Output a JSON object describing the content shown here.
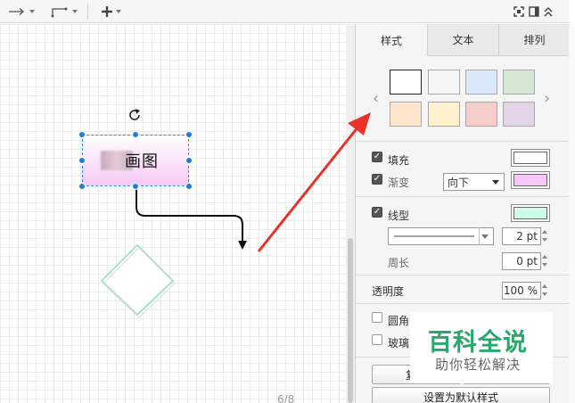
{
  "toolbar": {
    "connection_icon": "arrow-right-icon",
    "waypoint_icon": "waypoint-icon",
    "insert_icon": "plus-icon",
    "right_icons": [
      "fit-icon",
      "format-panel-icon",
      "collapse-icon"
    ]
  },
  "canvas": {
    "shape_label": "画图",
    "shape_gradient_color": "#f7c8f5",
    "diamond_stroke": "#9fe7c9",
    "page_indicator": "6/8"
  },
  "panel": {
    "tabs": [
      "样式",
      "文本",
      "排列"
    ],
    "active_tab": "样式",
    "swatches": [
      "#ffffff",
      "#f5f5f5",
      "#dae8fc",
      "#d5e8d4",
      "#ffe6cc",
      "#fff2cc",
      "#f8cecc",
      "#e1d5e7"
    ],
    "fill": {
      "label": "填充",
      "checked": true,
      "color": "#ffffff"
    },
    "gradient": {
      "label": "渐变",
      "checked": true,
      "direction": "向下",
      "color": "#f7c8f5"
    },
    "line": {
      "label": "线型",
      "checked": true,
      "color": "#ccffe6",
      "width": "2 pt"
    },
    "perimeter": {
      "label": "周长",
      "value": "0 pt"
    },
    "opacity": {
      "label": "透明度",
      "value": "100 %"
    },
    "rounded": {
      "label": "圆角",
      "checked": false
    },
    "glass": {
      "label": "玻璃",
      "checked": false
    },
    "copy_button": "复制",
    "default_style_button": "设置为默认样式"
  },
  "watermark": {
    "title": "百科全说",
    "subtitle": "助你轻松解决"
  },
  "annotation": {
    "arrow_color": "#e8322a"
  }
}
